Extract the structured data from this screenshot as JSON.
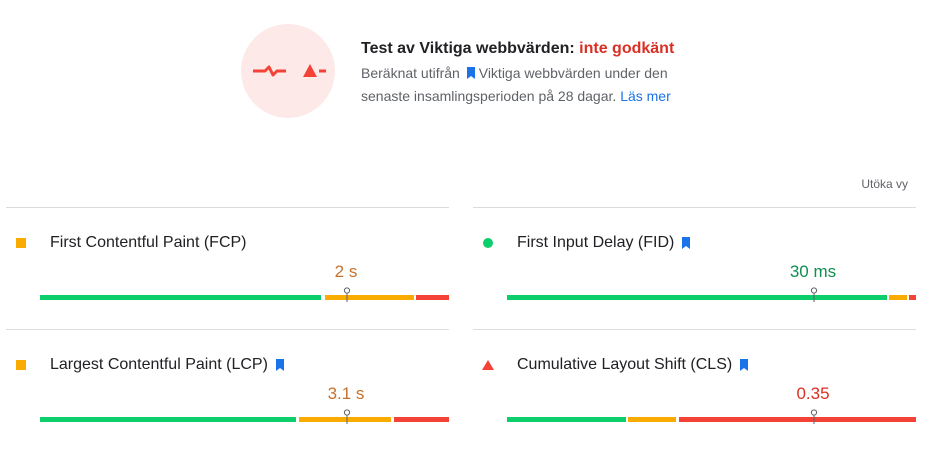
{
  "summary": {
    "title_prefix": "Test av Viktiga webbvärden:",
    "title_status": "inte godkänt",
    "desc_before": "Beräknat utifrån",
    "desc_link_label": "Viktiga webbvärden",
    "desc_after": "under den senaste insamlingsperioden på 28 dagar.",
    "learn_more": "Läs mer",
    "status_color": "#d93025"
  },
  "expand_label": "Utöka vy",
  "colors": {
    "good": "#0cce6b",
    "average": "#f9ab00",
    "poor": "#f44336"
  },
  "metrics": [
    {
      "name": "First Contentful Paint (FCP)",
      "value": "2 s",
      "status": "average",
      "indicator": "square",
      "has_bookmark": false,
      "distribution_percent": {
        "good": 69,
        "average": 22,
        "poor": 9
      },
      "marker_percent": 75
    },
    {
      "name": "First Input Delay (FID)",
      "value": "30 ms",
      "status": "good",
      "indicator": "circle",
      "has_bookmark": true,
      "distribution_percent": {
        "good": 93,
        "average": 5,
        "poor": 2
      },
      "marker_percent": 75
    },
    {
      "name": "Largest Contentful Paint (LCP)",
      "value": "3.1 s",
      "status": "average",
      "indicator": "square",
      "has_bookmark": true,
      "distribution_percent": {
        "good": 63,
        "average": 23,
        "poor": 14
      },
      "marker_percent": 75
    },
    {
      "name": "Cumulative Layout Shift (CLS)",
      "value": "0.35",
      "status": "poor",
      "indicator": "triangle",
      "has_bookmark": true,
      "distribution_percent": {
        "good": 29,
        "average": 12,
        "poor": 59
      },
      "marker_percent": 75
    }
  ]
}
